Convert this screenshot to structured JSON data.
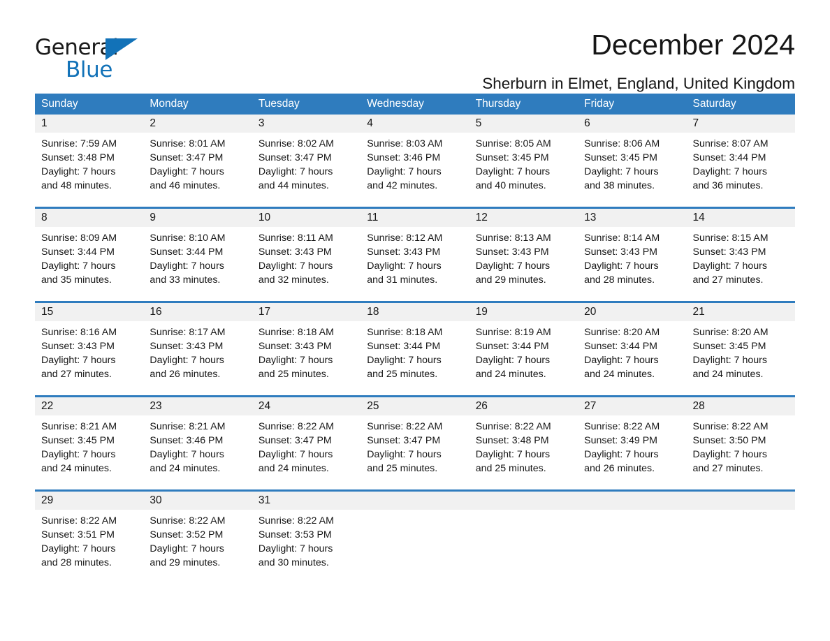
{
  "brand": {
    "name_part1": "General",
    "name_part2": "Blue",
    "accent_color": "#1272b8"
  },
  "header": {
    "title": "December 2024",
    "subtitle": "Sherburn in Elmet, England, United Kingdom"
  },
  "calendar": {
    "header_color": "#2f7cbe",
    "daynumber_band_color": "#f1f1f1",
    "weekdays": [
      "Sunday",
      "Monday",
      "Tuesday",
      "Wednesday",
      "Thursday",
      "Friday",
      "Saturday"
    ],
    "weeks": [
      {
        "days": [
          {
            "num": "1",
            "sunrise": "Sunrise: 7:59 AM",
            "sunset": "Sunset: 3:48 PM",
            "daylight1": "Daylight: 7 hours",
            "daylight2": "and 48 minutes."
          },
          {
            "num": "2",
            "sunrise": "Sunrise: 8:01 AM",
            "sunset": "Sunset: 3:47 PM",
            "daylight1": "Daylight: 7 hours",
            "daylight2": "and 46 minutes."
          },
          {
            "num": "3",
            "sunrise": "Sunrise: 8:02 AM",
            "sunset": "Sunset: 3:47 PM",
            "daylight1": "Daylight: 7 hours",
            "daylight2": "and 44 minutes."
          },
          {
            "num": "4",
            "sunrise": "Sunrise: 8:03 AM",
            "sunset": "Sunset: 3:46 PM",
            "daylight1": "Daylight: 7 hours",
            "daylight2": "and 42 minutes."
          },
          {
            "num": "5",
            "sunrise": "Sunrise: 8:05 AM",
            "sunset": "Sunset: 3:45 PM",
            "daylight1": "Daylight: 7 hours",
            "daylight2": "and 40 minutes."
          },
          {
            "num": "6",
            "sunrise": "Sunrise: 8:06 AM",
            "sunset": "Sunset: 3:45 PM",
            "daylight1": "Daylight: 7 hours",
            "daylight2": "and 38 minutes."
          },
          {
            "num": "7",
            "sunrise": "Sunrise: 8:07 AM",
            "sunset": "Sunset: 3:44 PM",
            "daylight1": "Daylight: 7 hours",
            "daylight2": "and 36 minutes."
          }
        ]
      },
      {
        "days": [
          {
            "num": "8",
            "sunrise": "Sunrise: 8:09 AM",
            "sunset": "Sunset: 3:44 PM",
            "daylight1": "Daylight: 7 hours",
            "daylight2": "and 35 minutes."
          },
          {
            "num": "9",
            "sunrise": "Sunrise: 8:10 AM",
            "sunset": "Sunset: 3:44 PM",
            "daylight1": "Daylight: 7 hours",
            "daylight2": "and 33 minutes."
          },
          {
            "num": "10",
            "sunrise": "Sunrise: 8:11 AM",
            "sunset": "Sunset: 3:43 PM",
            "daylight1": "Daylight: 7 hours",
            "daylight2": "and 32 minutes."
          },
          {
            "num": "11",
            "sunrise": "Sunrise: 8:12 AM",
            "sunset": "Sunset: 3:43 PM",
            "daylight1": "Daylight: 7 hours",
            "daylight2": "and 31 minutes."
          },
          {
            "num": "12",
            "sunrise": "Sunrise: 8:13 AM",
            "sunset": "Sunset: 3:43 PM",
            "daylight1": "Daylight: 7 hours",
            "daylight2": "and 29 minutes."
          },
          {
            "num": "13",
            "sunrise": "Sunrise: 8:14 AM",
            "sunset": "Sunset: 3:43 PM",
            "daylight1": "Daylight: 7 hours",
            "daylight2": "and 28 minutes."
          },
          {
            "num": "14",
            "sunrise": "Sunrise: 8:15 AM",
            "sunset": "Sunset: 3:43 PM",
            "daylight1": "Daylight: 7 hours",
            "daylight2": "and 27 minutes."
          }
        ]
      },
      {
        "days": [
          {
            "num": "15",
            "sunrise": "Sunrise: 8:16 AM",
            "sunset": "Sunset: 3:43 PM",
            "daylight1": "Daylight: 7 hours",
            "daylight2": "and 27 minutes."
          },
          {
            "num": "16",
            "sunrise": "Sunrise: 8:17 AM",
            "sunset": "Sunset: 3:43 PM",
            "daylight1": "Daylight: 7 hours",
            "daylight2": "and 26 minutes."
          },
          {
            "num": "17",
            "sunrise": "Sunrise: 8:18 AM",
            "sunset": "Sunset: 3:43 PM",
            "daylight1": "Daylight: 7 hours",
            "daylight2": "and 25 minutes."
          },
          {
            "num": "18",
            "sunrise": "Sunrise: 8:18 AM",
            "sunset": "Sunset: 3:44 PM",
            "daylight1": "Daylight: 7 hours",
            "daylight2": "and 25 minutes."
          },
          {
            "num": "19",
            "sunrise": "Sunrise: 8:19 AM",
            "sunset": "Sunset: 3:44 PM",
            "daylight1": "Daylight: 7 hours",
            "daylight2": "and 24 minutes."
          },
          {
            "num": "20",
            "sunrise": "Sunrise: 8:20 AM",
            "sunset": "Sunset: 3:44 PM",
            "daylight1": "Daylight: 7 hours",
            "daylight2": "and 24 minutes."
          },
          {
            "num": "21",
            "sunrise": "Sunrise: 8:20 AM",
            "sunset": "Sunset: 3:45 PM",
            "daylight1": "Daylight: 7 hours",
            "daylight2": "and 24 minutes."
          }
        ]
      },
      {
        "days": [
          {
            "num": "22",
            "sunrise": "Sunrise: 8:21 AM",
            "sunset": "Sunset: 3:45 PM",
            "daylight1": "Daylight: 7 hours",
            "daylight2": "and 24 minutes."
          },
          {
            "num": "23",
            "sunrise": "Sunrise: 8:21 AM",
            "sunset": "Sunset: 3:46 PM",
            "daylight1": "Daylight: 7 hours",
            "daylight2": "and 24 minutes."
          },
          {
            "num": "24",
            "sunrise": "Sunrise: 8:22 AM",
            "sunset": "Sunset: 3:47 PM",
            "daylight1": "Daylight: 7 hours",
            "daylight2": "and 24 minutes."
          },
          {
            "num": "25",
            "sunrise": "Sunrise: 8:22 AM",
            "sunset": "Sunset: 3:47 PM",
            "daylight1": "Daylight: 7 hours",
            "daylight2": "and 25 minutes."
          },
          {
            "num": "26",
            "sunrise": "Sunrise: 8:22 AM",
            "sunset": "Sunset: 3:48 PM",
            "daylight1": "Daylight: 7 hours",
            "daylight2": "and 25 minutes."
          },
          {
            "num": "27",
            "sunrise": "Sunrise: 8:22 AM",
            "sunset": "Sunset: 3:49 PM",
            "daylight1": "Daylight: 7 hours",
            "daylight2": "and 26 minutes."
          },
          {
            "num": "28",
            "sunrise": "Sunrise: 8:22 AM",
            "sunset": "Sunset: 3:50 PM",
            "daylight1": "Daylight: 7 hours",
            "daylight2": "and 27 minutes."
          }
        ]
      },
      {
        "days": [
          {
            "num": "29",
            "sunrise": "Sunrise: 8:22 AM",
            "sunset": "Sunset: 3:51 PM",
            "daylight1": "Daylight: 7 hours",
            "daylight2": "and 28 minutes."
          },
          {
            "num": "30",
            "sunrise": "Sunrise: 8:22 AM",
            "sunset": "Sunset: 3:52 PM",
            "daylight1": "Daylight: 7 hours",
            "daylight2": "and 29 minutes."
          },
          {
            "num": "31",
            "sunrise": "Sunrise: 8:22 AM",
            "sunset": "Sunset: 3:53 PM",
            "daylight1": "Daylight: 7 hours",
            "daylight2": "and 30 minutes."
          },
          {
            "num": "",
            "sunrise": "",
            "sunset": "",
            "daylight1": "",
            "daylight2": ""
          },
          {
            "num": "",
            "sunrise": "",
            "sunset": "",
            "daylight1": "",
            "daylight2": ""
          },
          {
            "num": "",
            "sunrise": "",
            "sunset": "",
            "daylight1": "",
            "daylight2": ""
          },
          {
            "num": "",
            "sunrise": "",
            "sunset": "",
            "daylight1": "",
            "daylight2": ""
          }
        ]
      }
    ]
  }
}
